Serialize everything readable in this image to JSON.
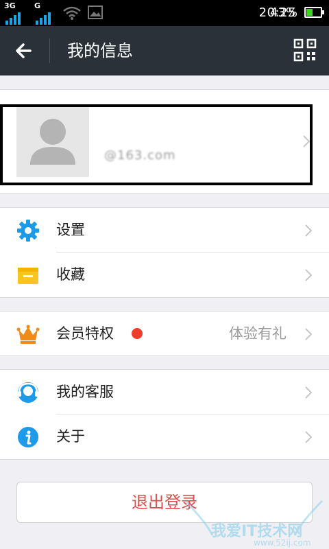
{
  "status_bar": {
    "sim1": "3G",
    "sim2": "G",
    "time": "20:25",
    "battery": "43%",
    "battery_level": 0.43,
    "icons": [
      "signal-icon",
      "wifi-icon",
      "image-icon",
      "battery-icon"
    ]
  },
  "header": {
    "title": "我的信息",
    "back_icon": "back-arrow-icon",
    "qr_icon": "qr-code-icon"
  },
  "profile": {
    "name": "",
    "email": "@163.com"
  },
  "menu": {
    "settings": "设置",
    "favorites": "收藏",
    "vip": "会员特权",
    "vip_aux": "体验有礼",
    "service": "我的客服",
    "about": "关于"
  },
  "logout": "退出登录",
  "watermark": {
    "title": "我爱IT技术网",
    "url": "www.52ij.com"
  },
  "colors": {
    "header_bg": "#2b3139",
    "accent_blue": "#1e9be8",
    "favorites_yellow": "#f7c51f",
    "vip_orange": "#f08a18",
    "badge_red": "#ef3c2b",
    "logout_red": "#e24b4b"
  }
}
